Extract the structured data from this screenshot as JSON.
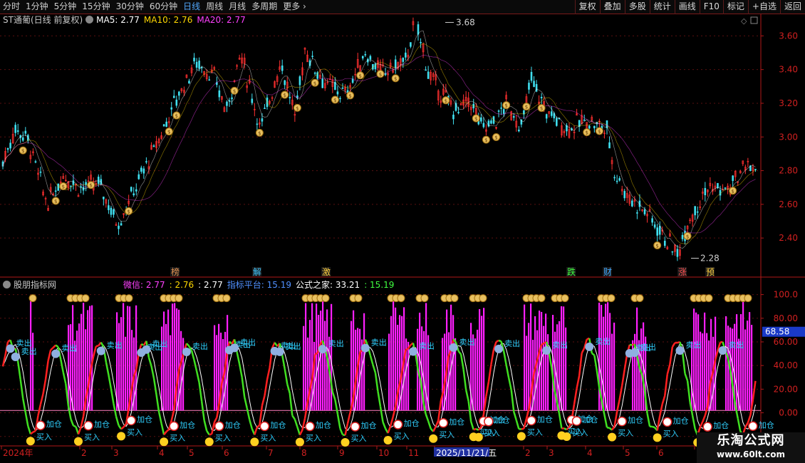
{
  "toolbar": {
    "periods": [
      "分时",
      "1分钟",
      "5分钟",
      "15分钟",
      "30分钟",
      "60分钟",
      "日线",
      "周线",
      "月线",
      "多周期",
      "更多"
    ],
    "active_period": "日线",
    "right_buttons": [
      "复权",
      "叠加",
      "多股",
      "统计",
      "画线",
      "F10",
      "标记",
      "+自选",
      "返回"
    ]
  },
  "upper": {
    "stock_title": "ST通葡(日线 前复权)",
    "ma": [
      {
        "label": "MA5:",
        "value": "2.77",
        "color": "#ffffff"
      },
      {
        "label": "MA10:",
        "value": "2.76",
        "color": "#ffd800"
      },
      {
        "label": "MA20:",
        "value": "2.77",
        "color": "#ff40ff"
      }
    ],
    "y_ticks": [
      "3.60",
      "3.40",
      "3.20",
      "3.00",
      "2.80",
      "2.60",
      "2.40"
    ],
    "y_values": [
      3.6,
      3.4,
      3.2,
      3.0,
      2.8,
      2.6,
      2.4
    ],
    "high_label": "3.68",
    "low_label": "2.28",
    "event_tags": [
      {
        "text": "榜",
        "color": "#e09050"
      },
      {
        "text": "解",
        "color": "#40c8ff"
      },
      {
        "text": "激",
        "color": "#ffd040"
      },
      {
        "text": "跌",
        "color": "#40ff40"
      },
      {
        "text": "财",
        "color": "#40a8ff"
      },
      {
        "text": "涨",
        "color": "#ff5050"
      },
      {
        "text": "预",
        "color": "#ffd040"
      }
    ]
  },
  "lower": {
    "indicator_title": "股朋指标网",
    "params": [
      {
        "text": "微信: 2.77",
        "color": "#ff40ff"
      },
      {
        "text": ": 2.76",
        "color": "#ffd800"
      },
      {
        "text": ": 2.77",
        "color": "#ffffff"
      },
      {
        "text": "指标平台: 15.19",
        "color": "#5090ff"
      },
      {
        "text": "公式之家: 33.21",
        "color": "#ffffff"
      },
      {
        "text": ": 15.19",
        "color": "#40ff40"
      }
    ],
    "y_ticks": [
      "100.0",
      "80.00",
      "60.00",
      "40.00",
      "20.00",
      "0.00",
      "-20.00"
    ],
    "y_values": [
      100,
      80,
      60,
      40,
      20,
      0,
      -20
    ],
    "current_value": "68.58",
    "signal_labels": {
      "buy": "买入",
      "sell": "卖出",
      "add": "加仓"
    }
  },
  "x_axis": {
    "labels": [
      "2024年",
      "2",
      "3",
      "4",
      "5",
      "6",
      "7",
      "8",
      "9",
      "10",
      "11",
      "2025/11/21/五",
      "2",
      "3",
      "4",
      "5",
      "6",
      "7"
    ]
  },
  "watermark": {
    "title": "乐淘公式网",
    "url": "www.60lt.com"
  }
}
